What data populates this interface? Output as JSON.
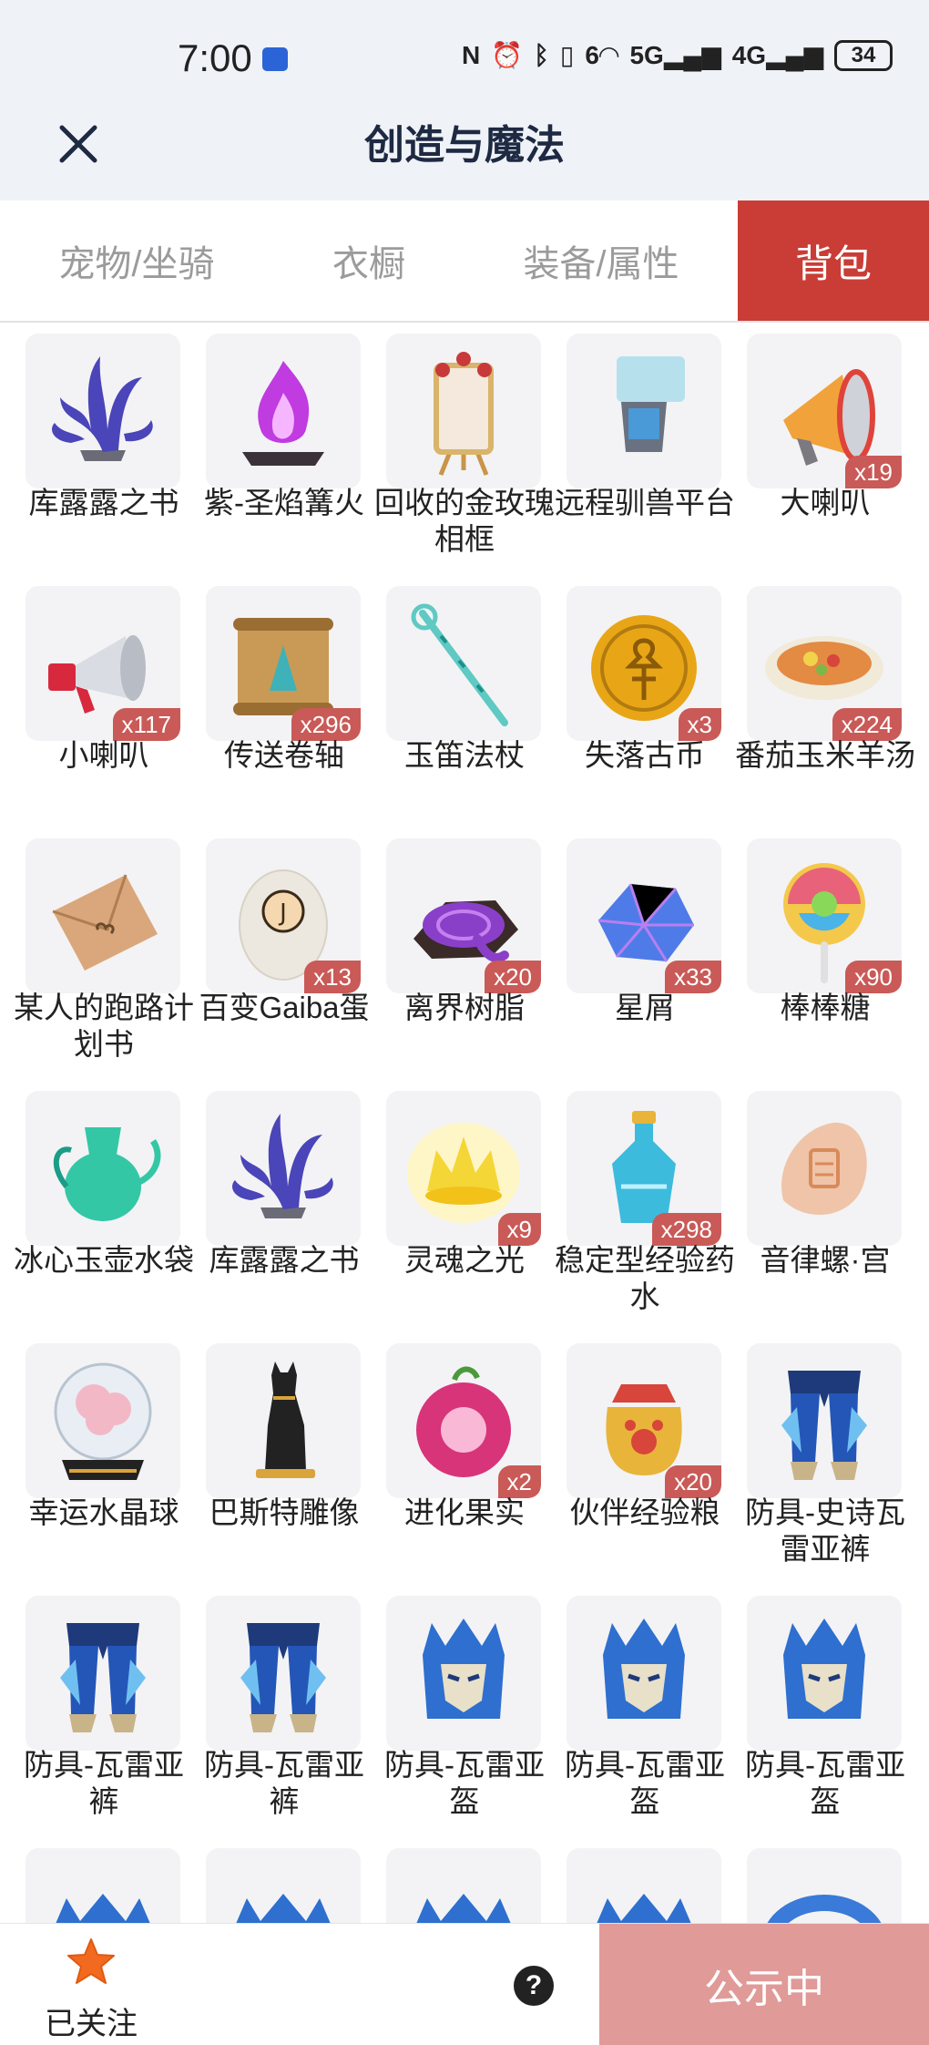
{
  "status_bar": {
    "time": "7:00",
    "network_labels": [
      "6",
      "5G",
      "4G"
    ],
    "battery": "34"
  },
  "header": {
    "title": "创造与魔法",
    "close_icon": "close-icon"
  },
  "tabs": [
    {
      "label": "宠物/坐骑",
      "active": false
    },
    {
      "label": "衣橱",
      "active": false
    },
    {
      "label": "装备/属性",
      "active": false
    },
    {
      "label": "背包",
      "active": true
    }
  ],
  "items": [
    {
      "name": "库露露之书",
      "qty": "",
      "icon": "tentacle-book-icon",
      "color": "#4a45b8"
    },
    {
      "name": "紫-圣焰篝火",
      "qty": "",
      "icon": "purple-bonfire-icon",
      "color": "#c03be0"
    },
    {
      "name": "回收的金玫瑰相框",
      "qty": "",
      "icon": "rose-frame-easel-icon",
      "color": "#d9b46a"
    },
    {
      "name": "远程驯兽平台",
      "qty": "",
      "icon": "remote-platform-icon",
      "color": "#8fd3e8"
    },
    {
      "name": "大喇叭",
      "qty": "x19",
      "icon": "big-megaphone-icon",
      "color": "#f2a23a"
    },
    {
      "name": "小喇叭",
      "qty": "x117",
      "icon": "small-megaphone-icon",
      "color": "#d8283e"
    },
    {
      "name": "传送卷轴",
      "qty": "x296",
      "icon": "teleport-scroll-icon",
      "color": "#c89a55"
    },
    {
      "name": "玉笛法杖",
      "qty": "",
      "icon": "jade-flute-staff-icon",
      "color": "#5fc9c3"
    },
    {
      "name": "失落古币",
      "qty": "x3",
      "icon": "ancient-coin-icon",
      "color": "#e8a617"
    },
    {
      "name": "番茄玉米羊汤",
      "qty": "x224",
      "icon": "soup-bowl-icon",
      "color": "#e38a43"
    },
    {
      "name": "某人的跑路计划书",
      "qty": "",
      "icon": "envelope-icon",
      "color": "#d9a77b"
    },
    {
      "name": "百变Gaiba蛋",
      "qty": "x13",
      "icon": "egg-icon",
      "color": "#ece8df"
    },
    {
      "name": "离界树脂",
      "qty": "x20",
      "icon": "resin-icon",
      "color": "#8a3fc9"
    },
    {
      "name": "星屑",
      "qty": "x33",
      "icon": "stardust-icon",
      "color": "#4f7be8"
    },
    {
      "name": "棒棒糖",
      "qty": "x90",
      "icon": "lollipop-icon",
      "color": "#e8637a"
    },
    {
      "name": "冰心玉壶水袋",
      "qty": "",
      "icon": "jade-pot-icon",
      "color": "#34c7a6"
    },
    {
      "name": "库露露之书",
      "qty": "",
      "icon": "tentacle-book-icon",
      "color": "#4a45b8"
    },
    {
      "name": "灵魂之光",
      "qty": "x9",
      "icon": "soul-light-icon",
      "color": "#f5d637"
    },
    {
      "name": "稳定型经验药水",
      "qty": "x298",
      "icon": "exp-potion-icon",
      "color": "#3dbbdd"
    },
    {
      "name": "音律螺·宫",
      "qty": "",
      "icon": "conch-icon",
      "color": "#f0c4a8"
    },
    {
      "name": "幸运水晶球",
      "qty": "",
      "icon": "crystal-ball-icon",
      "color": "#f2b8c6"
    },
    {
      "name": "巴斯特雕像",
      "qty": "",
      "icon": "bastet-statue-icon",
      "color": "#222222"
    },
    {
      "name": "进化果实",
      "qty": "x2",
      "icon": "evolution-fruit-icon",
      "color": "#d8347a"
    },
    {
      "name": "伙伴经验粮",
      "qty": "x20",
      "icon": "pet-food-bag-icon",
      "color": "#e8b43a"
    },
    {
      "name": "防具-史诗瓦雷亚裤",
      "qty": "",
      "icon": "armor-pants-icon",
      "color": "#2456b8"
    },
    {
      "name": "防具-瓦雷亚裤",
      "qty": "",
      "icon": "armor-pants-icon",
      "color": "#2456b8"
    },
    {
      "name": "防具-瓦雷亚裤",
      "qty": "",
      "icon": "armor-pants-icon",
      "color": "#2456b8"
    },
    {
      "name": "防具-瓦雷亚盔",
      "qty": "",
      "icon": "armor-helmet-icon",
      "color": "#2e6fd0"
    },
    {
      "name": "防具-瓦雷亚盔",
      "qty": "",
      "icon": "armor-helmet-icon",
      "color": "#2e6fd0"
    },
    {
      "name": "防具-瓦雷亚盔",
      "qty": "",
      "icon": "armor-helmet-icon",
      "color": "#2e6fd0"
    },
    {
      "name": "",
      "qty": "",
      "icon": "armor-partial-icon",
      "color": "#2e6fd0"
    },
    {
      "name": "",
      "qty": "",
      "icon": "armor-partial-icon",
      "color": "#2e6fd0"
    },
    {
      "name": "",
      "qty": "",
      "icon": "armor-partial-icon",
      "color": "#2e6fd0"
    },
    {
      "name": "",
      "qty": "",
      "icon": "armor-partial-icon",
      "color": "#2e6fd0"
    },
    {
      "name": "",
      "qty": "",
      "icon": "armor-ring-icon",
      "color": "#3a7ad8"
    }
  ],
  "bottom_bar": {
    "follow_label": "已关注",
    "help_label": "?",
    "public_label": "公示中"
  },
  "colors": {
    "active_tab": "#c93d36",
    "qty_badge": "#c95a57",
    "public_button": "#e09a98",
    "follow_star": "#f26a1f"
  }
}
